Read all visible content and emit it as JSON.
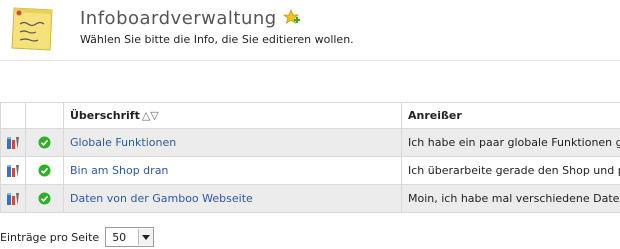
{
  "header": {
    "title": "Infoboardverwaltung",
    "subtitle": "Wählen Sie bitte die Info, die Sie editieren wollen."
  },
  "table": {
    "columns": {
      "title": "Überschrift",
      "sort": "△▽",
      "teaser": "Anreißer"
    },
    "rows": [
      {
        "title": "Globale Funktionen",
        "teaser": "Ich habe ein paar globale Funktionen geschrieben",
        "status": "active"
      },
      {
        "title": "Bin am Shop dran",
        "teaser": "Ich überarbeite gerade den Shop und passe ihn an",
        "status": "active"
      },
      {
        "title": "Daten von der Gamboo Webseite",
        "teaser": "Moin, ich habe mal verschiedene Daten zusammengetragen",
        "status": "active"
      }
    ]
  },
  "footer": {
    "label": "Einträge pro Seite",
    "page_size": "50"
  },
  "colors": {
    "link": "#2d5a9c",
    "alt_row": "#ececec",
    "check": "#2fae2a"
  }
}
